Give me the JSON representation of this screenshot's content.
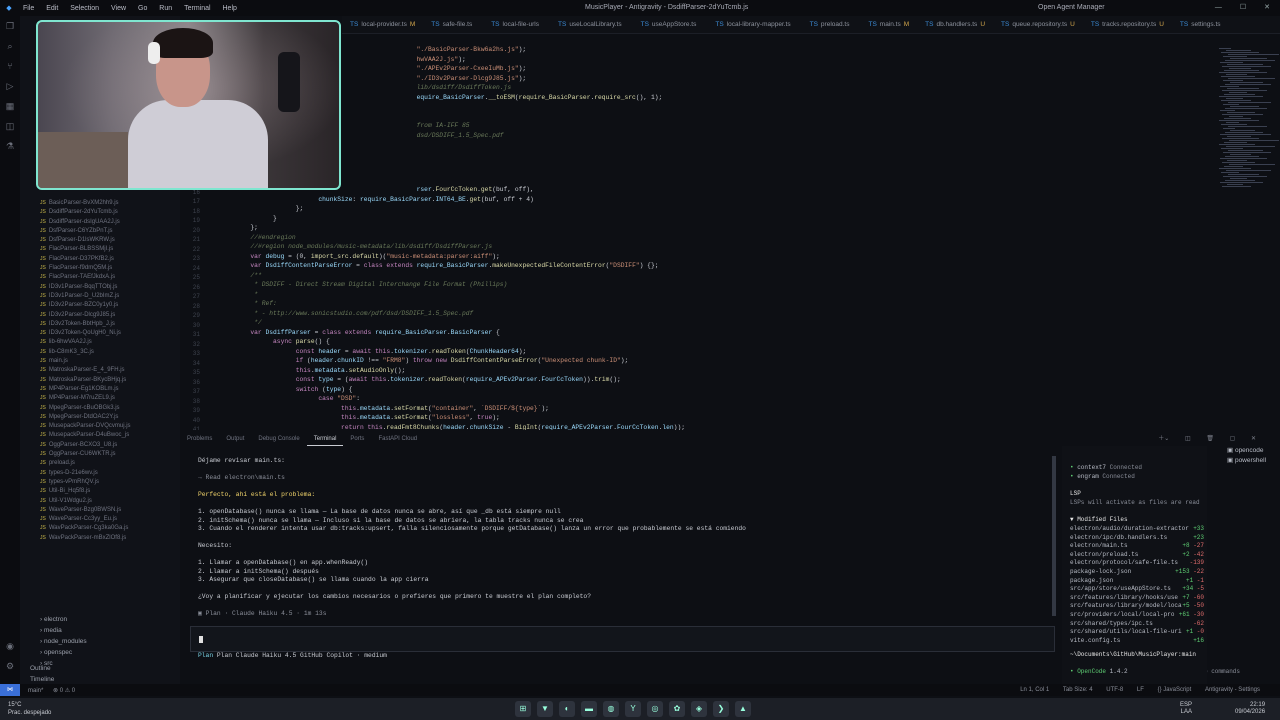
{
  "titlebar": {
    "menu": [
      "File",
      "Edit",
      "Selection",
      "View",
      "Go",
      "Run",
      "Terminal",
      "Help"
    ],
    "title": "MusicPlayer - Antigravity - DsdiffParser-2dYuTcmb.js",
    "agent_manager": "Open Agent Manager"
  },
  "tabs": [
    {
      "label": "local-provider.ts",
      "mod": "M"
    },
    {
      "label": "safe-file.ts",
      "mod": ""
    },
    {
      "label": "local-file-urls",
      "mod": ""
    },
    {
      "label": "useLocalLibrary.ts",
      "mod": ""
    },
    {
      "label": "useAppStore.ts",
      "mod": ""
    },
    {
      "label": "local-library-mapper.ts",
      "mod": ""
    },
    {
      "label": "preload.ts",
      "mod": ""
    },
    {
      "label": "main.ts",
      "mod": "M"
    },
    {
      "label": "db.handlers.ts",
      "mod": "U"
    },
    {
      "label": "queue.repository.ts",
      "mod": "U"
    },
    {
      "label": "tracks.repository.ts",
      "mod": "U"
    },
    {
      "label": "settings.ts",
      "mod": ""
    }
  ],
  "sidebar": {
    "files": [
      "BasicParser-BvXM2hh9.js",
      "DsdiffParser-2dYuTcmb.js",
      "DsdiffParser-dsIgUAA2J.js",
      "DsfParser-C6YZbPnT.js",
      "DsfParser-D1lsWKRW.js",
      "FlacParser-BLBSSMjI.js",
      "FlacParser-D37PKfB2.js",
      "FlacParser-f9dmQ5M.js",
      "FlacParser-TAEfJkdxA.js",
      "ID3v1Parser-BqqTTObj.js",
      "ID3v1Parser-D_U2bImZ.js",
      "ID3v2Parser-BZC0y1y0.js",
      "ID3v2Parser-Dlcg9J85.js",
      "ID3v2Token-BbtHpb_J.js",
      "ID3v2Token-QoUgH0_Ni.js",
      "lib-6hwVAA2J.js",
      "lib-C8mK3_3C.js",
      "main.js",
      "MatroskaParser-E_4_9FH.js",
      "MatroskaParser-BKycBHjq.js",
      "MP4Parser-Eg1KOBLm.js",
      "MP4Parser-M7ruZEL9.js",
      "MpegParser-cBuOBGk3.js",
      "MpegParser-DtdOAC2Y.js",
      "MusepackParser-DVQcvmuj.js",
      "MusepackParser-D4uBwoc_js",
      "OggParser-BCXO3_U8.js",
      "OggParser-CU6WKTR.js",
      "preload.js",
      "types-D-21e6wv.js",
      "types-vPmRhQV.js",
      "Util-Bi_Hq5f8.js",
      "Util-V1Wdgu2.js",
      "WaveParser-Bzg0BWSN.js",
      "WaveParser-Cc3yy_Eu.js",
      "WavPackParser-Cg3ka0Ga.js",
      "WavPackParser-mBxZlOf8.js"
    ],
    "folders": [
      "electron",
      "media",
      "node_modules",
      "openspec",
      "src"
    ],
    "outline": "Outline",
    "timeline": "Timeline"
  },
  "editor": {
    "line_numbers": [
      "1",
      "2",
      "3",
      "4",
      "5",
      "6",
      "7",
      "8",
      "9",
      "10",
      "11",
      "12",
      "13",
      "14",
      "15",
      "16",
      "17",
      "18",
      "19",
      "20",
      "21",
      "22",
      "23",
      "24",
      "25",
      "26",
      "27",
      "28",
      "29",
      "30",
      "31",
      "32",
      "33",
      "34",
      "35",
      "36",
      "37",
      "38",
      "39",
      "40",
      "41"
    ]
  },
  "panel": {
    "tabs": [
      "Problems",
      "Output",
      "Debug Console",
      "Terminal",
      "Ports",
      "FastAPI Cloud"
    ],
    "active": "Terminal"
  },
  "terminal": {
    "lines": [
      {
        "cls": "",
        "text": "Déjame revisar main.ts:"
      },
      {
        "cls": "dim",
        "text": "→ Read electron\\main.ts"
      },
      {
        "cls": "yellow",
        "text": "Perfecto, ahí está el problema:"
      },
      {
        "cls": "",
        "text": "1. openDatabase() nunca se llama — La base de datos nunca se abre, así que _db está siempre null"
      },
      {
        "cls": "",
        "text": "2. initSchema() nunca se llama — Incluso si la base de datos se abriera, la tabla tracks nunca se crea"
      },
      {
        "cls": "",
        "text": "3. Cuando el renderer intenta usar db:tracks:upsert, falla silenciosamente porque getDatabase() lanza un error que probablemente se está comiendo"
      },
      {
        "cls": "",
        "text": "Necesito:"
      },
      {
        "cls": "",
        "text": "1. Llamar a openDatabase() en app.whenReady()"
      },
      {
        "cls": "",
        "text": "2. Llamar a initSchema() después"
      },
      {
        "cls": "",
        "text": "3. Asegurar que closeDatabase() se llama cuando la app cierra"
      },
      {
        "cls": "",
        "text": "¿Voy a planificar y ejecutar los cambios necesarios o prefieres que primero te muestre el plan completo?"
      },
      {
        "cls": "dim",
        "text": "▣ Plan · Claude Haiku 4.5 · 1m 13s"
      }
    ],
    "status": "Plan  Claude Haiku 4.5 GitHub Copilot · medium",
    "tokens": "62.7K (44%)  ctrl+p commands"
  },
  "right": {
    "mcp": [
      {
        "name": "context7",
        "state": "Connected"
      },
      {
        "name": "engram",
        "state": "Connected"
      }
    ],
    "lsp_title": "LSP",
    "lsp_note": "LSPs will activate as files are read",
    "modified_title": "▼ Modified Files",
    "modified": [
      {
        "file": "electron/audio/duration-extractor",
        "add": "+33",
        "del": ""
      },
      {
        "file": "electron/ipc/db.handlers.ts",
        "add": "+23",
        "del": ""
      },
      {
        "file": "electron/main.ts",
        "add": "+8",
        "del": "-27"
      },
      {
        "file": "electron/preload.ts",
        "add": "+2",
        "del": "-42"
      },
      {
        "file": "electron/protocol/safe-file.ts",
        "add": "",
        "del": "-139"
      },
      {
        "file": "package-lock.json",
        "add": "+153",
        "del": "-22"
      },
      {
        "file": "package.json",
        "add": "+1",
        "del": "-1"
      },
      {
        "file": "src/app/store/useAppStore.ts",
        "add": "+34",
        "del": "-5"
      },
      {
        "file": "src/features/library/hooks/use",
        "add": "+7",
        "del": "-60"
      },
      {
        "file": "src/features/library/model/loca",
        "add": "+5",
        "del": "-50"
      },
      {
        "file": "src/providers/local/local-pro",
        "add": "+61",
        "del": "-30"
      },
      {
        "file": "src/shared/types/ipc.ts",
        "add": "",
        "del": "-62"
      },
      {
        "file": "src/shared/utils/local-file-uri",
        "add": "+1",
        "del": "-0"
      },
      {
        "file": "vite.config.ts",
        "add": "+16",
        "del": ""
      }
    ],
    "path": "~\\Documents\\GitHub\\MusicPlayer:main",
    "version_label": "• OpenCode",
    "version": "1.4.2"
  },
  "terminals": [
    "opencode",
    "powershell"
  ],
  "statusbar": {
    "branch": "main*",
    "errors": "⊗ 0 ⚠ 0",
    "position": "Ln 1, Col 1",
    "tab": "Tab Size: 4",
    "enc": "UTF-8",
    "eol": "LF",
    "lang": "{} JavaScript",
    "ag": "Antigravity - Settings"
  },
  "taskbar": {
    "temp": "15°C",
    "weather": "Prac. despejado",
    "lang1": "ESP",
    "lang2": "LAA",
    "time": "22:19",
    "date": "09/04/2026"
  }
}
